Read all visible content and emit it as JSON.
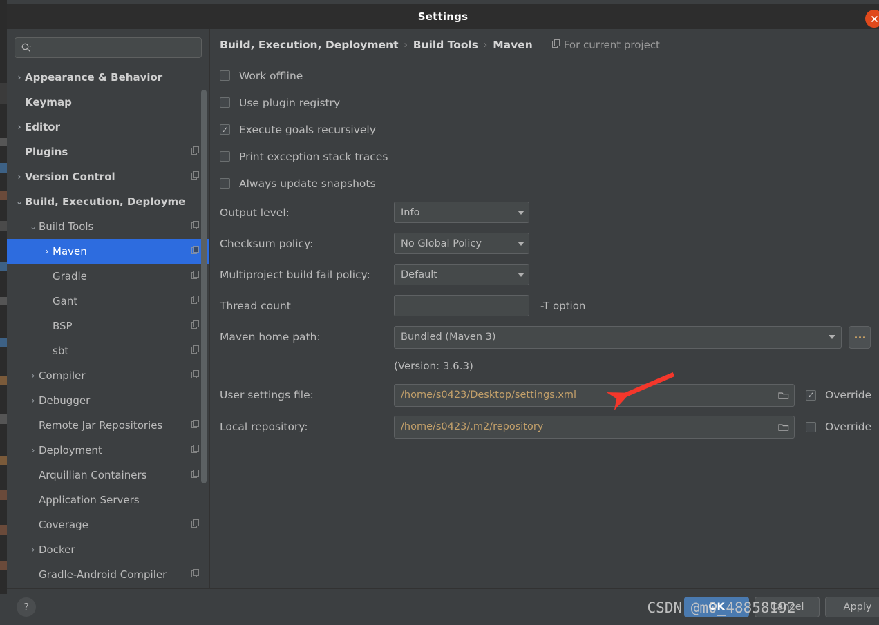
{
  "window": {
    "title": "Settings",
    "close_icon": "close-icon"
  },
  "sidebar": {
    "search": {
      "value": "",
      "placeholder": "",
      "icon": "search-icon"
    },
    "items": [
      {
        "label": "Appearance & Behavior",
        "chevron": "›",
        "indent": 0,
        "bold": true,
        "copy": false,
        "selected": false
      },
      {
        "label": "Keymap",
        "chevron": "",
        "indent": 0,
        "bold": true,
        "copy": false,
        "selected": false
      },
      {
        "label": "Editor",
        "chevron": "›",
        "indent": 0,
        "bold": true,
        "copy": false,
        "selected": false
      },
      {
        "label": "Plugins",
        "chevron": "",
        "indent": 0,
        "bold": true,
        "copy": true,
        "selected": false
      },
      {
        "label": "Version Control",
        "chevron": "›",
        "indent": 0,
        "bold": true,
        "copy": true,
        "selected": false
      },
      {
        "label": "Build, Execution, Deployme",
        "chevron": "⌄",
        "indent": 0,
        "bold": true,
        "copy": false,
        "selected": false
      },
      {
        "label": "Build Tools",
        "chevron": "⌄",
        "indent": 1,
        "bold": false,
        "copy": true,
        "selected": false
      },
      {
        "label": "Maven",
        "chevron": "›",
        "indent": 2,
        "bold": false,
        "copy": true,
        "selected": true
      },
      {
        "label": "Gradle",
        "chevron": "",
        "indent": 2,
        "bold": false,
        "copy": true,
        "selected": false
      },
      {
        "label": "Gant",
        "chevron": "",
        "indent": 2,
        "bold": false,
        "copy": true,
        "selected": false
      },
      {
        "label": "BSP",
        "chevron": "",
        "indent": 2,
        "bold": false,
        "copy": true,
        "selected": false
      },
      {
        "label": "sbt",
        "chevron": "",
        "indent": 2,
        "bold": false,
        "copy": true,
        "selected": false
      },
      {
        "label": "Compiler",
        "chevron": "›",
        "indent": 1,
        "bold": false,
        "copy": true,
        "selected": false
      },
      {
        "label": "Debugger",
        "chevron": "›",
        "indent": 1,
        "bold": false,
        "copy": false,
        "selected": false
      },
      {
        "label": "Remote Jar Repositories",
        "chevron": "",
        "indent": 1,
        "bold": false,
        "copy": true,
        "selected": false
      },
      {
        "label": "Deployment",
        "chevron": "›",
        "indent": 1,
        "bold": false,
        "copy": true,
        "selected": false
      },
      {
        "label": "Arquillian Containers",
        "chevron": "",
        "indent": 1,
        "bold": false,
        "copy": true,
        "selected": false
      },
      {
        "label": "Application Servers",
        "chevron": "",
        "indent": 1,
        "bold": false,
        "copy": false,
        "selected": false
      },
      {
        "label": "Coverage",
        "chevron": "",
        "indent": 1,
        "bold": false,
        "copy": true,
        "selected": false
      },
      {
        "label": "Docker",
        "chevron": "›",
        "indent": 1,
        "bold": false,
        "copy": false,
        "selected": false
      },
      {
        "label": "Gradle-Android Compiler",
        "chevron": "",
        "indent": 1,
        "bold": false,
        "copy": true,
        "selected": false
      }
    ]
  },
  "content": {
    "breadcrumb": {
      "part1": "Build, Execution, Deployment",
      "sep1": "›",
      "part2": "Build Tools",
      "sep2": "›",
      "part3": "Maven",
      "for_project": "For current project"
    },
    "checkboxes": [
      {
        "label": "Work offline",
        "checked": false
      },
      {
        "label": "Use plugin registry",
        "checked": false
      },
      {
        "label": "Execute goals recursively",
        "checked": true
      },
      {
        "label": "Print exception stack traces",
        "checked": false
      },
      {
        "label": "Always update snapshots",
        "checked": false
      }
    ],
    "fields": {
      "output_level": {
        "label": "Output level:",
        "value": "Info"
      },
      "checksum_policy": {
        "label": "Checksum policy:",
        "value": "No Global Policy"
      },
      "multiproject": {
        "label": "Multiproject build fail policy:",
        "value": "Default"
      },
      "thread_count": {
        "label": "Thread count",
        "value": "",
        "placeholder": "",
        "suffix": "-T option"
      },
      "maven_home": {
        "label": "Maven home path:",
        "value": "Bundled (Maven 3)",
        "browse": "..."
      },
      "version_note": "(Version: 3.6.3)",
      "user_settings": {
        "label": "User settings file:",
        "value": "/home/s0423/Desktop/settings.xml",
        "override_label": "Override",
        "override_checked": true
      },
      "local_repo": {
        "label": "Local repository:",
        "value": "/home/s0423/.m2/repository",
        "override_label": "Override",
        "override_checked": false
      }
    }
  },
  "footer": {
    "help_label": "?",
    "ok_label": "OK",
    "cancel_label": "Cancel",
    "apply_label": "Apply"
  },
  "annotations": {
    "watermark": "CSDN @m0_48858192",
    "arrow_color": "#f4372b"
  },
  "colors": {
    "accent": "#2d6cdf",
    "primary_button": "#4a7ab0",
    "panel_bg": "#3c3f41",
    "field_bg": "#45494a",
    "text": "#bbbbbb",
    "path_text": "#c3a06a",
    "close_button": "#e0491c"
  }
}
